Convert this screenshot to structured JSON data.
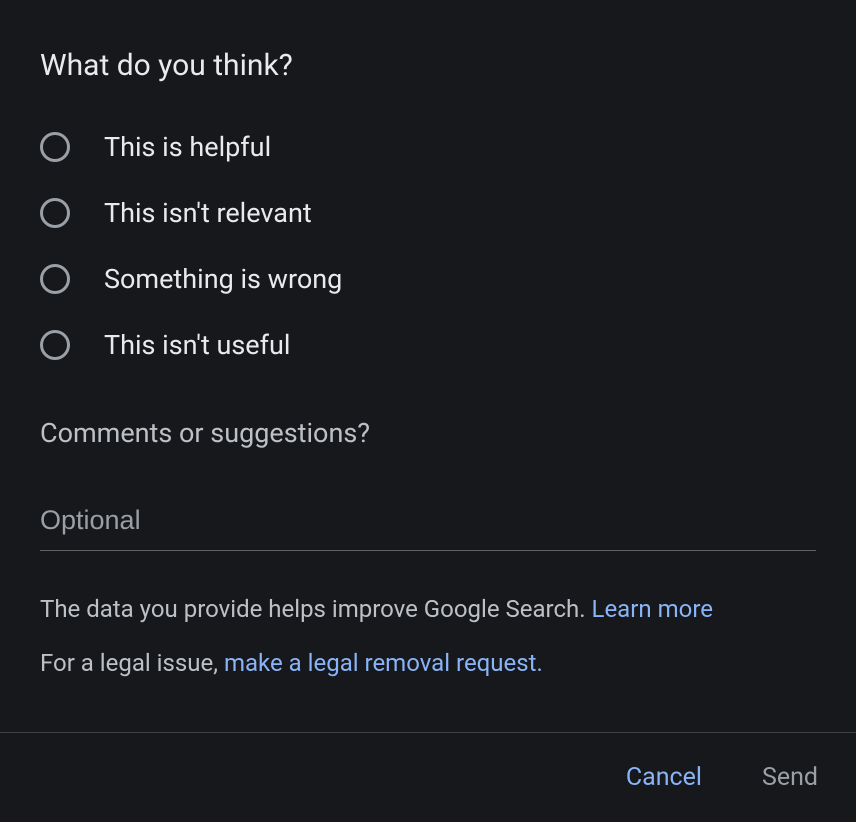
{
  "title": "What do you think?",
  "options": [
    {
      "label": "This is helpful"
    },
    {
      "label": "This isn't relevant"
    },
    {
      "label": "Something is wrong"
    },
    {
      "label": "This isn't useful"
    }
  ],
  "comments": {
    "heading": "Comments or suggestions?",
    "placeholder": "Optional"
  },
  "info": {
    "line1_text": "The data you provide helps improve Google Search. ",
    "line1_link": "Learn more",
    "line2_text": "For a legal issue, ",
    "line2_link": "make a legal removal request."
  },
  "footer": {
    "cancel": "Cancel",
    "send": "Send"
  }
}
